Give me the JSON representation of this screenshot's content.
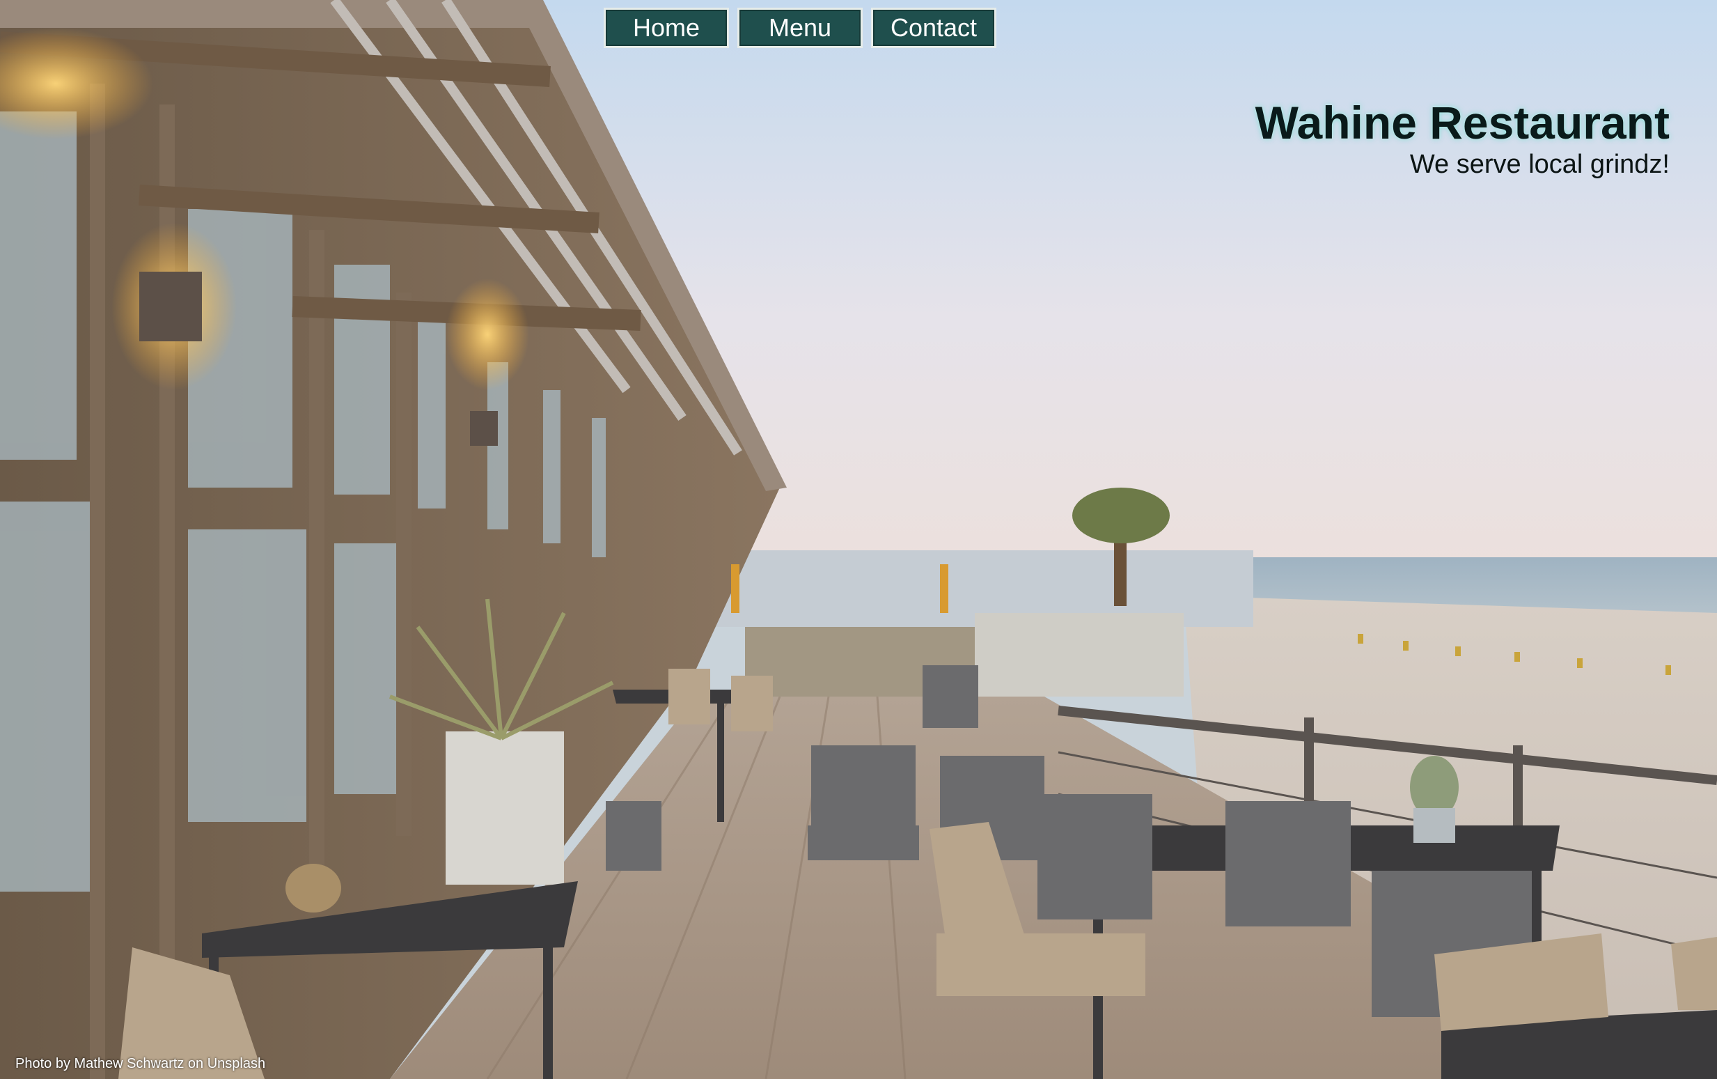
{
  "nav": {
    "items": [
      {
        "label": "Home"
      },
      {
        "label": "Menu"
      },
      {
        "label": "Contact"
      }
    ]
  },
  "brand": {
    "title": "Wahine Restaurant",
    "tagline": "We serve local grindz!"
  },
  "photo": {
    "credit": "Photo by Mathew Schwartz on Unsplash",
    "subject": "beach-restaurant-terrace"
  },
  "colors": {
    "nav_bg": "#1f4f4d",
    "nav_text": "#ffffff",
    "title_glow": "#78dcd2"
  }
}
